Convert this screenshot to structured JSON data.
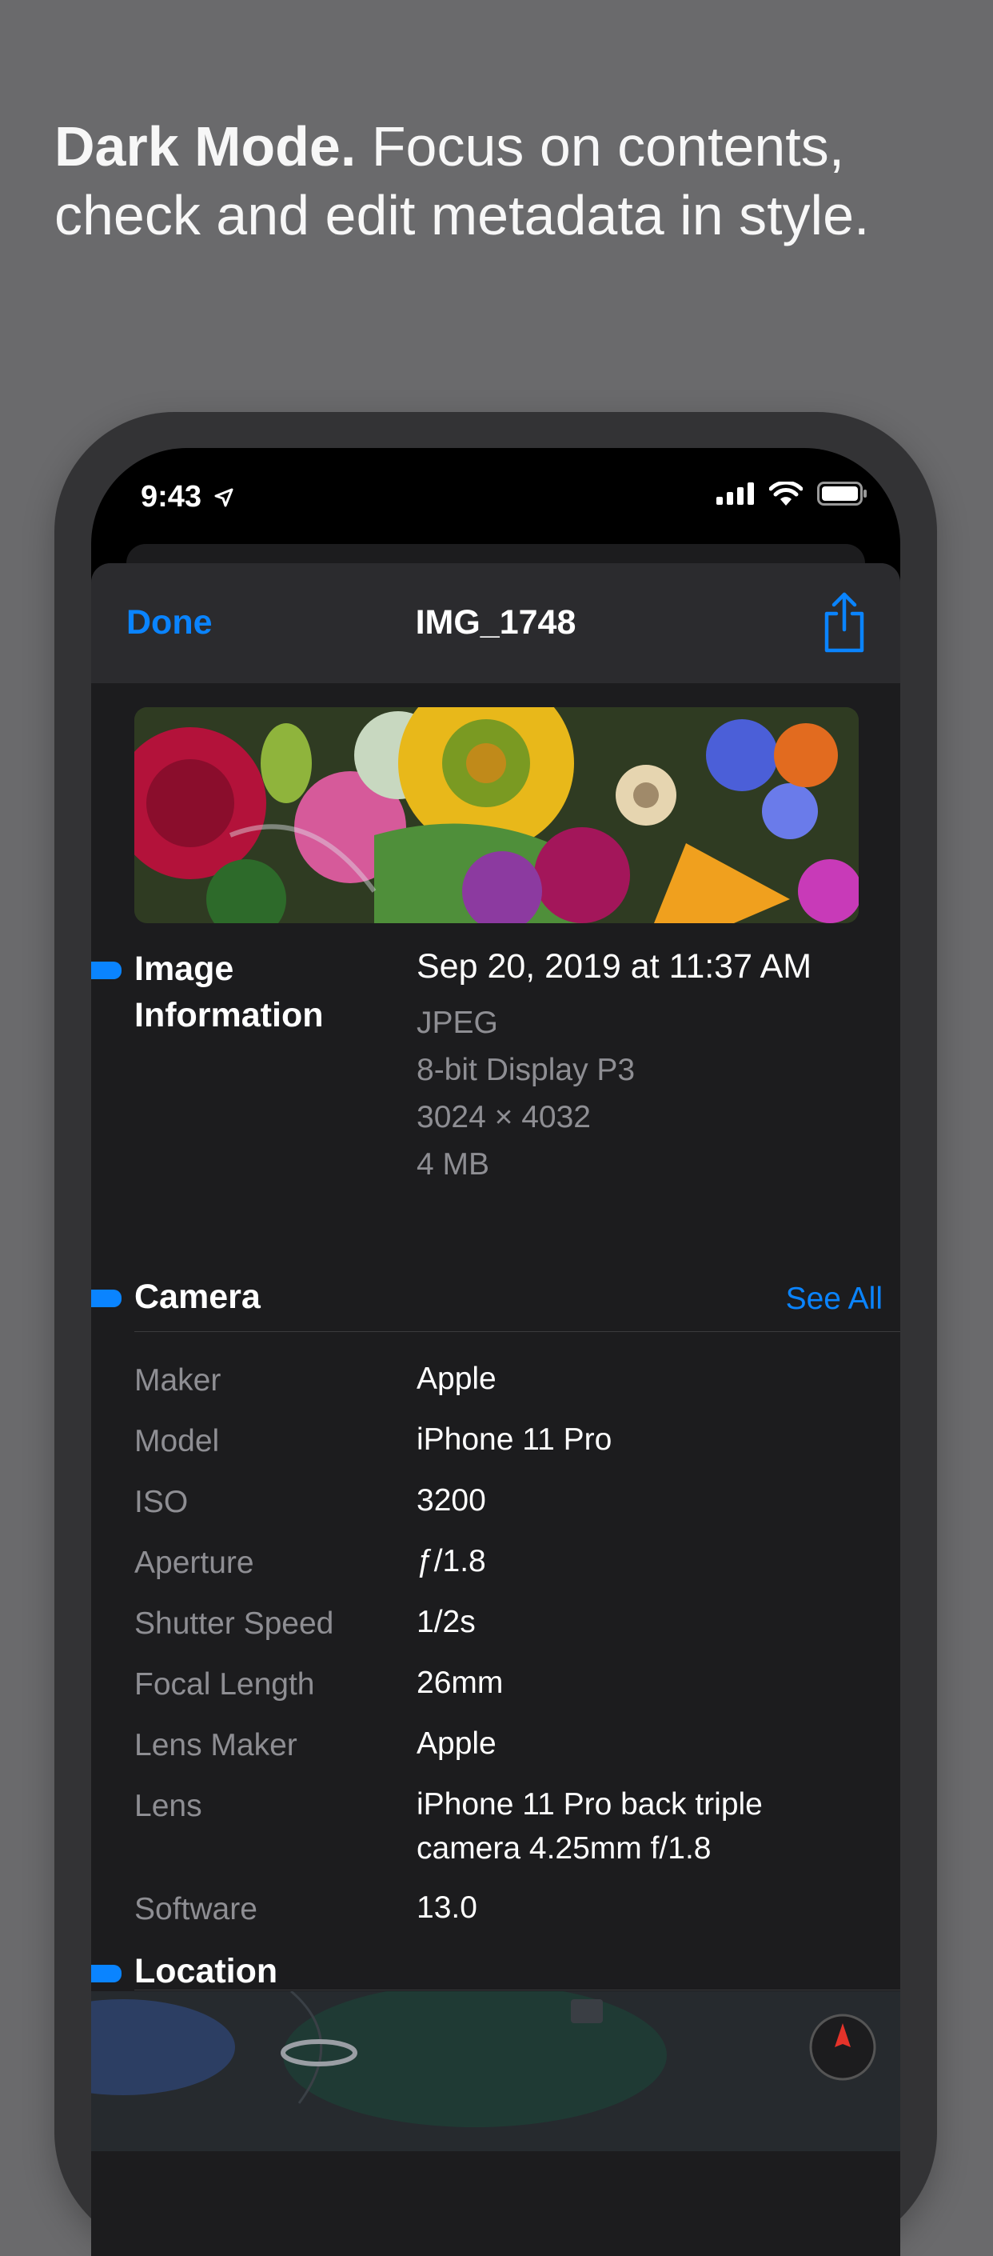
{
  "headline": {
    "bold": "Dark Mode.",
    "text": " Focus on contents, check and edit metadata in style."
  },
  "status_bar": {
    "time": "9:43",
    "icons": [
      "location-arrow-icon",
      "cellular-signal-icon",
      "wifi-icon",
      "battery-icon"
    ]
  },
  "nav": {
    "done_label": "Done",
    "title": "IMG_1748",
    "share_icon": "share-icon"
  },
  "image_info": {
    "section_title": "Image Information",
    "date": "Sep 20, 2019 at 11:37 AM",
    "format": "JPEG",
    "color_profile": "8-bit Display P3",
    "dimensions": "3024 × 4032",
    "size": "4 MB"
  },
  "camera": {
    "section_title": "Camera",
    "see_all_label": "See All",
    "rows": [
      {
        "label": "Maker",
        "value": "Apple"
      },
      {
        "label": "Model",
        "value": "iPhone 11 Pro"
      },
      {
        "label": "ISO",
        "value": "3200"
      },
      {
        "label": "Aperture",
        "value": "ƒ/1.8"
      },
      {
        "label": "Shutter Speed",
        "value": "1/2s"
      },
      {
        "label": "Focal Length",
        "value": "26mm"
      },
      {
        "label": "Lens Maker",
        "value": "Apple"
      },
      {
        "label": "Lens",
        "value": "iPhone 11 Pro back triple camera 4.25mm f/1.8"
      },
      {
        "label": "Software",
        "value": "13.0"
      }
    ]
  },
  "location": {
    "section_title": "Location"
  },
  "colors": {
    "accent": "#0a84ff",
    "sheet_background": "#1c1c1e",
    "secondary_text": "#8e8e93"
  }
}
